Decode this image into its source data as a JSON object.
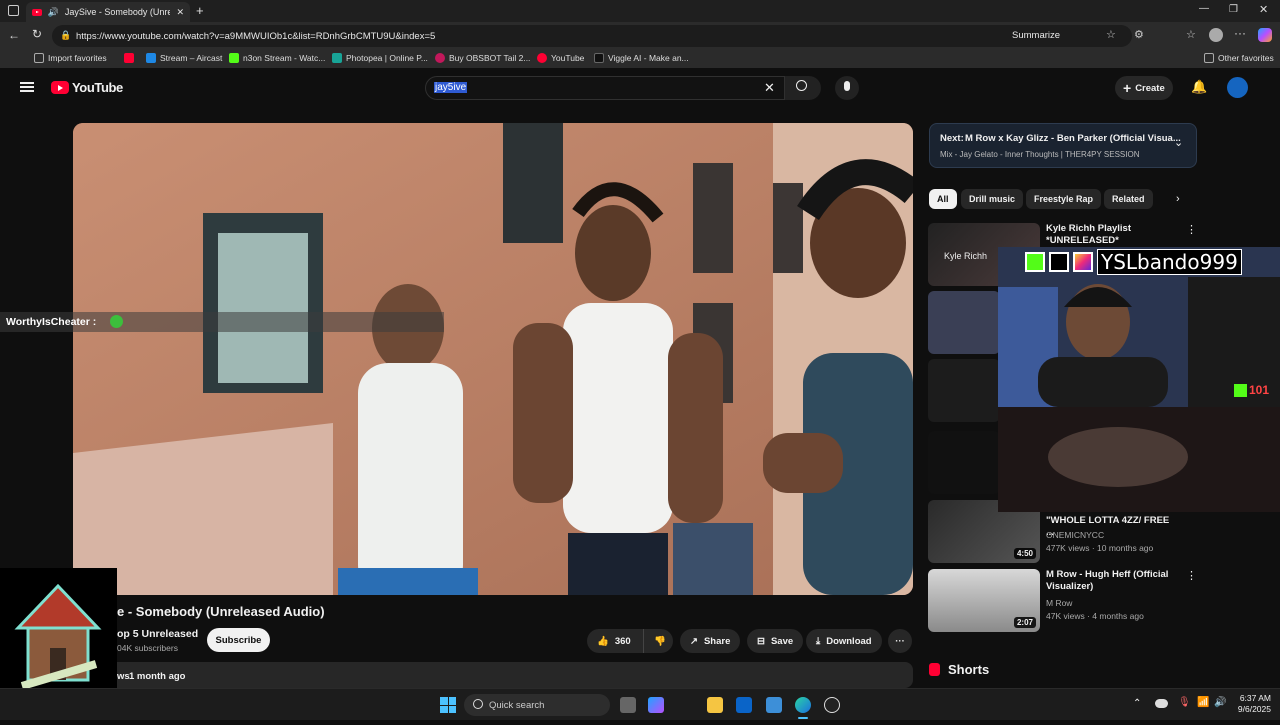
{
  "browser": {
    "tab_title": "JaySive - Somebody (Unrele",
    "url": "https://www.youtube.com/watch?v=a9MMWUIOb1c&list=RDnhGrbCMTU9U&index=5",
    "summarize_label": "Summarize",
    "bookmarks": [
      {
        "label": "Import favorites",
        "color": "#888888"
      },
      {
        "label": "Stream – Aircast",
        "color": "#1e88e5"
      },
      {
        "label": "n3on Stream - Watc...",
        "color": "#53fc18"
      },
      {
        "label": "Photopea | Online P...",
        "color": "#18a497"
      },
      {
        "label": "Buy OBSBOT Tail 2...",
        "color": "#c2185b"
      },
      {
        "label": "YouTube",
        "color": "#ff0033"
      },
      {
        "label": "Viggle AI - Make an...",
        "color": "#ffffff"
      }
    ],
    "other_favorites": "Other favorites"
  },
  "youtube": {
    "logo_text": "YouTube",
    "search_value": "jay5ive",
    "create_label": "Create",
    "video_title": "e - Somebody (Unreleased Audio)",
    "channel_name": "op 5 Unreleased",
    "subscribers": "04K subscribers",
    "subscribe_label": "Subscribe",
    "likes": "360",
    "share_label": "Share",
    "save_label": "Save",
    "download_label": "Download",
    "views_prefix": "ws",
    "upload_age": "1 month ago",
    "next_label": "Next:",
    "next_title": "M Row x Kay Glizz - Ben Parker (Official Visua...",
    "next_sub": "Mix - Jay Gelato - Inner Thoughts | THER4PY SESSION",
    "chips": [
      "All",
      "Drill music",
      "Freestyle Rap",
      "Related"
    ],
    "recs": [
      {
        "title": "Kyle Richh Playlist *UNRELEASED*",
        "channel": "",
        "meta": "",
        "duration": ""
      },
      {
        "title": "\"WHOLE LOTTA 4ZZ/ FREE ...",
        "channel": "ONEMICNYCC",
        "meta": "477K views · 10 months ago",
        "duration": "4:50"
      },
      {
        "title": "M Row - Hugh Heff (Official Visualizer)",
        "channel": "M Row",
        "meta": "47K views · 4 months ago",
        "duration": "2:07"
      }
    ],
    "shorts_label": "Shorts"
  },
  "overlay": {
    "chat_user": "WorthyIsCheater :",
    "streamer_handle": "YSLbando999",
    "viewer_count": "101"
  },
  "taskbar": {
    "search_placeholder": "Quick search",
    "time": "6:37 AM",
    "date": "9/6/2025"
  }
}
